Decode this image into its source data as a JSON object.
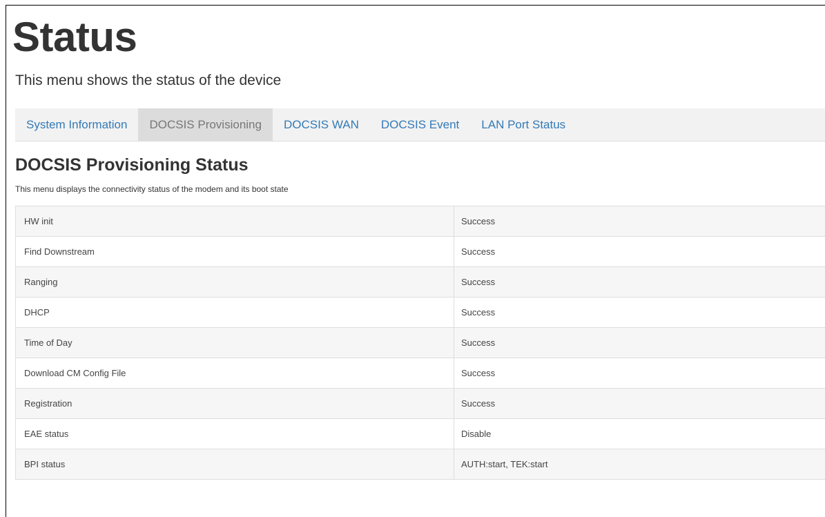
{
  "page": {
    "title": "Status",
    "subtitle": "This menu shows the status of the device"
  },
  "tabs": [
    {
      "label": "System Information",
      "active": false
    },
    {
      "label": "DOCSIS Provisioning",
      "active": true
    },
    {
      "label": "DOCSIS WAN",
      "active": false
    },
    {
      "label": "DOCSIS Event",
      "active": false
    },
    {
      "label": "LAN Port Status",
      "active": false
    }
  ],
  "section": {
    "title": "DOCSIS Provisioning Status",
    "description": "This menu displays the connectivity status of the modem and its boot state"
  },
  "table": {
    "rows": [
      {
        "label": "HW init",
        "value": "Success"
      },
      {
        "label": "Find Downstream",
        "value": "Success"
      },
      {
        "label": "Ranging",
        "value": "Success"
      },
      {
        "label": "DHCP",
        "value": "Success"
      },
      {
        "label": "Time of Day",
        "value": "Success"
      },
      {
        "label": "Download CM Config File",
        "value": "Success"
      },
      {
        "label": "Registration",
        "value": "Success"
      },
      {
        "label": "EAE status",
        "value": "Disable"
      },
      {
        "label": "BPI status",
        "value": "AUTH:start, TEK:start"
      }
    ]
  },
  "colors": {
    "link": "#337ab7",
    "active_tab_text": "#777777",
    "active_tab_bg": "#dcdcdc",
    "tabbar_bg": "#f2f2f2",
    "text": "#333333"
  }
}
